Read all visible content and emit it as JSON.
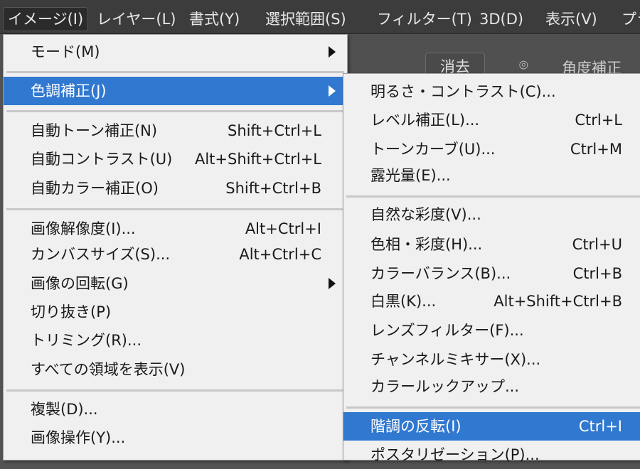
{
  "menubar": [
    "イメージ(I)",
    "レイヤー(L)",
    "書式(Y)",
    "選択範囲(S)",
    "フィルター(T)",
    "3D(D)",
    "表示(V)",
    "プラ"
  ],
  "options": {
    "clear_button": "消去",
    "straighten": "角度補正"
  },
  "image_menu": [
    {
      "label": "モード(M)",
      "submenu": true
    },
    {
      "label": "色調補正(J)",
      "submenu": true,
      "highlighted": true
    },
    {
      "label": "自動トーン補正(N)",
      "shortcut": "Shift+Ctrl+L"
    },
    {
      "label": "自動コントラスト(U)",
      "shortcut": "Alt+Shift+Ctrl+L"
    },
    {
      "label": "自動カラー補正(O)",
      "shortcut": "Shift+Ctrl+B"
    },
    {
      "label": "画像解像度(I)...",
      "shortcut": "Alt+Ctrl+I"
    },
    {
      "label": "カンバスサイズ(S)...",
      "shortcut": "Alt+Ctrl+C"
    },
    {
      "label": "画像の回転(G)",
      "submenu": true
    },
    {
      "label": "切り抜き(P)"
    },
    {
      "label": "トリミング(R)..."
    },
    {
      "label": "すべての領域を表示(V)"
    },
    {
      "label": "複製(D)..."
    },
    {
      "label": "画像操作(Y)..."
    }
  ],
  "adjust_menu": [
    {
      "label": "明るさ・コントラスト(C)..."
    },
    {
      "label": "レベル補正(L)...",
      "shortcut": "Ctrl+L"
    },
    {
      "label": "トーンカーブ(U)...",
      "shortcut": "Ctrl+M"
    },
    {
      "label": "露光量(E)..."
    },
    {
      "label": "自然な彩度(V)..."
    },
    {
      "label": "色相・彩度(H)...",
      "shortcut": "Ctrl+U"
    },
    {
      "label": "カラーバランス(B)...",
      "shortcut": "Ctrl+B"
    },
    {
      "label": "白黒(K)...",
      "shortcut": "Alt+Shift+Ctrl+B"
    },
    {
      "label": "レンズフィルター(F)..."
    },
    {
      "label": "チャンネルミキサー(X)..."
    },
    {
      "label": "カラールックアップ..."
    },
    {
      "label": "階調の反転(I)",
      "shortcut": "Ctrl+I",
      "highlighted": true
    },
    {
      "label": "ポスタリゼーション(P)..."
    }
  ]
}
